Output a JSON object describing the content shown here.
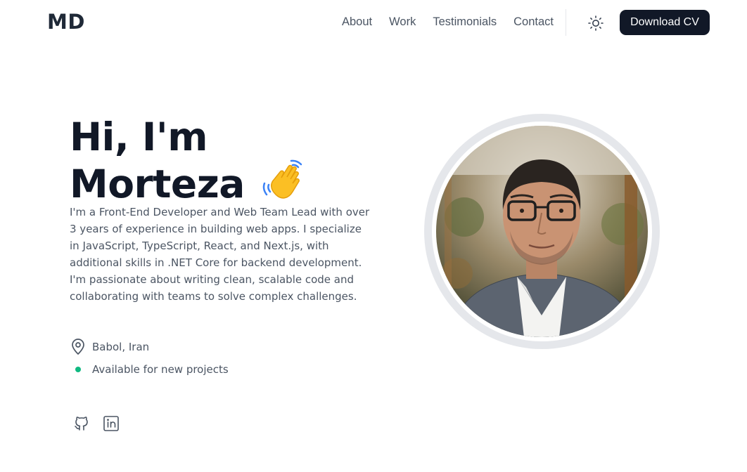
{
  "header": {
    "logo": "MD",
    "nav": [
      "About",
      "Work",
      "Testimonials",
      "Contact"
    ],
    "theme_icon": "sun-icon",
    "cv_button": "Download CV"
  },
  "hero": {
    "title_line1": "Hi, I'm",
    "title_line2": "Morteza",
    "emoji": "waving-hand-icon",
    "bio": "I'm a Front-End Developer and Web Team Lead with over 3 years of experience in building web apps. I specialize in JavaScript, TypeScript, React, and Next.js, with additional skills in .NET Core for backend development. I'm passionate about writing clean, scalable code and collaborating with teams to solve complex challenges.",
    "location": "Babol, Iran",
    "availability": "Available for new projects",
    "availability_color": "#10b981"
  },
  "socials": [
    "github-icon",
    "linkedin-icon"
  ],
  "colors": {
    "text_dark": "#111827",
    "text_muted": "#4b5563",
    "button_bg": "#111827",
    "ring": "#e5e7eb"
  }
}
